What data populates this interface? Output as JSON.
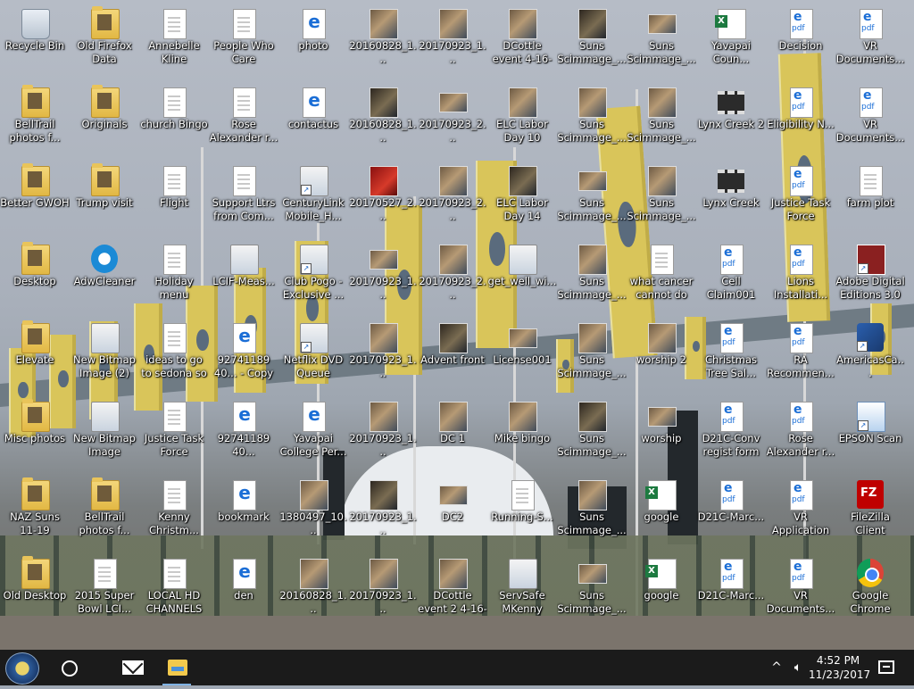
{
  "desktop": {
    "icons": [
      {
        "label": "Recycle Bin",
        "icon": "recycle-bin-icon"
      },
      {
        "label": "Old Firefox Data",
        "icon": "folder-icon"
      },
      {
        "label": "Annebelle Kline",
        "icon": "document-icon"
      },
      {
        "label": "People Who Care",
        "icon": "document-icon"
      },
      {
        "label": "photo",
        "icon": "edge-html-icon"
      },
      {
        "label": "20160828_1...",
        "icon": "photo-icon"
      },
      {
        "label": "20170923_1...",
        "icon": "photo-icon"
      },
      {
        "label": "DCottle event 4-16-16",
        "icon": "photo-icon"
      },
      {
        "label": "Suns Scimmage_...",
        "icon": "photo-icon"
      },
      {
        "label": "Suns Scimmage_...",
        "icon": "photo-icon"
      },
      {
        "label": "Yavapai Coun...",
        "icon": "excel-icon"
      },
      {
        "label": "Decision",
        "icon": "pdf-icon"
      },
      {
        "label": "VR Documents...",
        "icon": "pdf-icon"
      },
      {
        "label": "BellTrail photos f...",
        "icon": "folder-icon"
      },
      {
        "label": "Originals",
        "icon": "folder-icon"
      },
      {
        "label": "church Bingo",
        "icon": "document-icon"
      },
      {
        "label": "Rose Alexander r...",
        "icon": "document-icon"
      },
      {
        "label": "contactus",
        "icon": "edge-html-icon"
      },
      {
        "label": "20160828_1...",
        "icon": "photo-icon"
      },
      {
        "label": "20170923_2...",
        "icon": "photo-icon"
      },
      {
        "label": "ELC Labor Day 10",
        "icon": "photo-icon"
      },
      {
        "label": "Suns Scimmage_...",
        "icon": "photo-icon"
      },
      {
        "label": "Suns Scimmage_...",
        "icon": "photo-icon"
      },
      {
        "label": "Lynx Creek 2",
        "icon": "video-icon"
      },
      {
        "label": "Eligibility N...",
        "icon": "pdf-icon"
      },
      {
        "label": "VR Documents...",
        "icon": "pdf-icon"
      },
      {
        "label": "Better GWOH",
        "icon": "folder-icon"
      },
      {
        "label": "Trump visit",
        "icon": "folder-icon"
      },
      {
        "label": "Flight",
        "icon": "document-icon"
      },
      {
        "label": "Support Ltrs from Com...",
        "icon": "document-icon"
      },
      {
        "label": "CenturyLink Mobile_H...",
        "icon": "app-shortcut-icon"
      },
      {
        "label": "20170527_2...",
        "icon": "photo-icon"
      },
      {
        "label": "20170923_2...",
        "icon": "photo-icon"
      },
      {
        "label": "ELC Labor Day 14",
        "icon": "photo-icon"
      },
      {
        "label": "Suns Scimmage_...",
        "icon": "photo-icon"
      },
      {
        "label": "Suns Scimmage_...",
        "icon": "photo-icon"
      },
      {
        "label": "Lynx Creek",
        "icon": "video-icon"
      },
      {
        "label": "Justice Task Force",
        "icon": "pdf-icon"
      },
      {
        "label": "farm plot",
        "icon": "document-icon"
      },
      {
        "label": "Desktop",
        "icon": "folder-icon"
      },
      {
        "label": "AdwCleaner",
        "icon": "adwcleaner-icon"
      },
      {
        "label": "Holiday menu",
        "icon": "document-icon"
      },
      {
        "label": "LCIF-Meas...",
        "icon": "app-icon"
      },
      {
        "label": "Club Pogo - Exclusive ...",
        "icon": "app-shortcut-icon"
      },
      {
        "label": "20170923_1...",
        "icon": "photo-icon"
      },
      {
        "label": "20170923_2...",
        "icon": "photo-icon"
      },
      {
        "label": "get_well_wi...",
        "icon": "app-icon"
      },
      {
        "label": "Suns Scimmage_...",
        "icon": "photo-icon"
      },
      {
        "label": "what cancer cannot do",
        "icon": "document-icon"
      },
      {
        "label": "Cell Claim001",
        "icon": "pdf-icon"
      },
      {
        "label": "Lions Installati...",
        "icon": "pdf-icon"
      },
      {
        "label": "Adobe Digital Editions 3.0",
        "icon": "adobe-icon"
      },
      {
        "label": "Elevate",
        "icon": "folder-icon"
      },
      {
        "label": "New Bitmap Image (2)",
        "icon": "bitmap-icon"
      },
      {
        "label": "ideas to go to sedona so far",
        "icon": "document-icon"
      },
      {
        "label": "92741189 40... - Copy",
        "icon": "edge-html-icon"
      },
      {
        "label": "Netflix DVD Queue",
        "icon": "app-shortcut-icon"
      },
      {
        "label": "20170923_1...",
        "icon": "photo-icon"
      },
      {
        "label": "Advent front",
        "icon": "photo-icon"
      },
      {
        "label": "License001",
        "icon": "photo-icon"
      },
      {
        "label": "Suns Scimmage_...",
        "icon": "photo-icon"
      },
      {
        "label": "worship 2",
        "icon": "photo-icon"
      },
      {
        "label": "Christmas Tree Sal...",
        "icon": "pdf-icon"
      },
      {
        "label": "RA Recommen...",
        "icon": "pdf-icon"
      },
      {
        "label": "AmericasCa...",
        "icon": "star-app-icon"
      },
      {
        "label": "Misc photos",
        "icon": "folder-icon"
      },
      {
        "label": "New Bitmap Image",
        "icon": "bitmap-icon"
      },
      {
        "label": "Justice Task Force",
        "icon": "document-icon"
      },
      {
        "label": "92741189 40...",
        "icon": "edge-html-icon"
      },
      {
        "label": "Yavapai College Per...",
        "icon": "edge-html-icon"
      },
      {
        "label": "20170923_1...",
        "icon": "photo-icon"
      },
      {
        "label": "DC 1",
        "icon": "photo-icon"
      },
      {
        "label": "Mike bingo",
        "icon": "photo-icon"
      },
      {
        "label": "Suns Scimmage_...",
        "icon": "photo-icon"
      },
      {
        "label": "worship",
        "icon": "photo-icon"
      },
      {
        "label": "D21C-Conv regist form",
        "icon": "pdf-icon"
      },
      {
        "label": "Rose Alexander r...",
        "icon": "pdf-icon"
      },
      {
        "label": "EPSON Scan",
        "icon": "epson-icon"
      },
      {
        "label": "NAZ Suns 11-19",
        "icon": "folder-icon"
      },
      {
        "label": "BellTrail photos f...",
        "icon": "folder-icon"
      },
      {
        "label": "Kenny Christm...",
        "icon": "document-icon"
      },
      {
        "label": "bookmark",
        "icon": "edge-html-icon"
      },
      {
        "label": "1380497_10...",
        "icon": "photo-icon"
      },
      {
        "label": "20170923_1...",
        "icon": "photo-icon"
      },
      {
        "label": "DC2",
        "icon": "photo-icon"
      },
      {
        "label": "Running-S...",
        "icon": "document-icon"
      },
      {
        "label": "Suns Scimmage_...",
        "icon": "photo-icon"
      },
      {
        "label": "google",
        "icon": "excel-icon"
      },
      {
        "label": "D21C-Marc...",
        "icon": "pdf-icon"
      },
      {
        "label": "VR Application",
        "icon": "pdf-icon"
      },
      {
        "label": "FileZilla Client",
        "icon": "filezilla-icon"
      },
      {
        "label": "Old Desktop",
        "icon": "folder-icon"
      },
      {
        "label": "2015 Super Bowl LCI...",
        "icon": "document-icon"
      },
      {
        "label": "LOCAL HD CHANNELS",
        "icon": "document-icon"
      },
      {
        "label": "den",
        "icon": "edge-html-icon"
      },
      {
        "label": "20160828_1...",
        "icon": "photo-icon"
      },
      {
        "label": "20170923_1...",
        "icon": "photo-icon"
      },
      {
        "label": "DCottle event 2 4-16-16",
        "icon": "photo-icon"
      },
      {
        "label": "ServSafe MKenny",
        "icon": "app-icon"
      },
      {
        "label": "Suns Scimmage_...",
        "icon": "photo-icon"
      },
      {
        "label": "google",
        "icon": "excel-icon"
      },
      {
        "label": "D21C-Marc...",
        "icon": "pdf-icon"
      },
      {
        "label": "VR Documents...",
        "icon": "pdf-icon"
      },
      {
        "label": "Google Chrome",
        "icon": "chrome-icon"
      }
    ]
  },
  "taskbar": {
    "start_icon": "start-button-icon",
    "search_icon": "cortana-circle-icon",
    "pinned": [
      {
        "icon": "mail-icon"
      },
      {
        "icon": "file-explorer-icon"
      }
    ],
    "tray_chevron": "^",
    "volume_icon": "volume-icon",
    "time": "4:52 PM",
    "date": "11/23/2017",
    "notification_icon": "action-center-icon"
  },
  "colors": {
    "taskbar_bg": "#1b1b1b",
    "label_text": "#ffffff",
    "flag_yellow": "#d9c55a"
  }
}
